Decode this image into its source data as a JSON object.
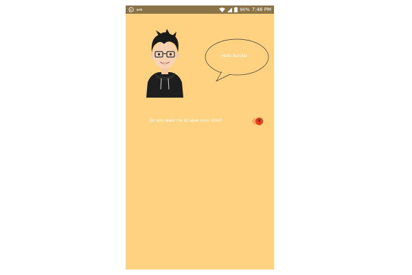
{
  "status_bar": {
    "time": "7:46 PM",
    "battery": "90%",
    "left_icons": [
      "whatsapp-icon",
      "infinity-icon"
    ],
    "right_icons": [
      "wifi-icon",
      "signal-icon",
      "battery-icon"
    ]
  },
  "colors": {
    "background": "#ffd282",
    "status_bar": "#8a7348",
    "text": "#ffffff",
    "accent": "#e8401c"
  },
  "chat": {
    "greeting": "Hello Sundar",
    "question": "Do you want me to save your time?",
    "yes_button_label": "Y"
  }
}
